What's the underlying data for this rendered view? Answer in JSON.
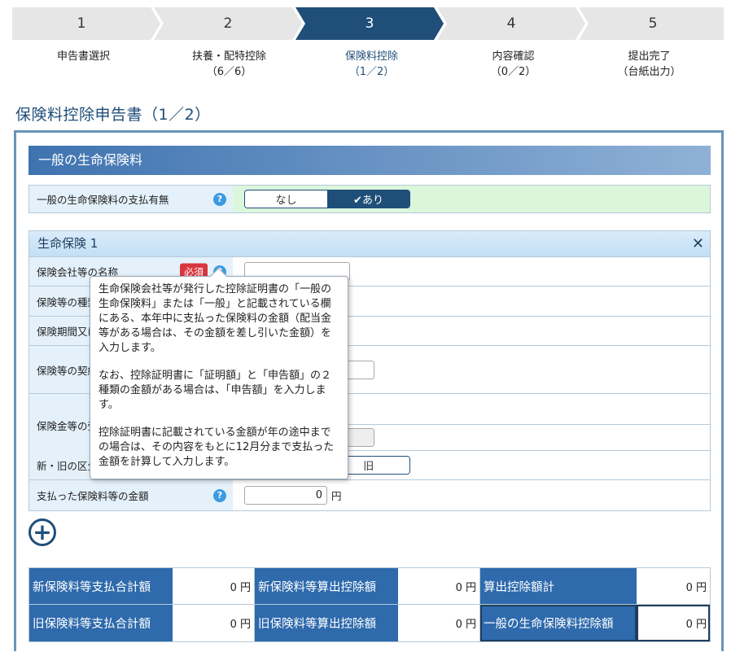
{
  "colors": {
    "primary": "#1f4e79",
    "active_step": "#1f4e79",
    "inactive_step": "#e6e6e6",
    "label_bg": "#e4f1fb",
    "toggle_area_bg": "#dcf6dc",
    "required": "#d9363e",
    "summary_label": "#2e6aac"
  },
  "steps": [
    {
      "number": "1",
      "label": "申告書選択",
      "sub": ""
    },
    {
      "number": "2",
      "label": "扶養・配特控除",
      "sub": "（6／6）"
    },
    {
      "number": "3",
      "label": "保険料控除",
      "sub": "（1／2）",
      "active": true
    },
    {
      "number": "4",
      "label": "内容確認",
      "sub": "（0／2）"
    },
    {
      "number": "5",
      "label": "提出完了",
      "sub": "（台紙出力）"
    }
  ],
  "page_title": "保険料控除申告書（1／2）",
  "section": {
    "title": "一般の生命保険料",
    "payment_row": {
      "label": "一般の生命保険料の支払有無",
      "help_icon": "question-circle-icon",
      "option_no": "なし",
      "option_yes": "✔あり"
    }
  },
  "insurance": {
    "title": "生命保険 1",
    "close_icon": "close-icon",
    "rows": {
      "company": {
        "label": "保険会社等の名称",
        "required": "必須"
      },
      "type": {
        "label": "保険等の種類"
      },
      "period": {
        "label": "保険期間又は年金支払期間"
      },
      "contractor": {
        "label": "保険等の契約者の氏名"
      },
      "recipient": {
        "label": "保険金等の受取人"
      },
      "new_old": {
        "label": "新・旧の区分",
        "old_option": "旧"
      },
      "amount": {
        "label": "支払った保険料等の金額",
        "value": "0",
        "unit": "円"
      }
    }
  },
  "tooltip": {
    "para1": "生命保険会社等が発行した控除証明書の「一般の生命保険料」または「一般」と記載されている欄にある、本年中に支払った保険料の金額（配当金等がある場合は、その金額を差し引いた金額）を入力します。",
    "para2": "なお、控除証明書に「証明額」と「申告額」の２種類の金額がある場合は、「申告額」を入力します。",
    "para3": "控除証明書に記載されている金額が年の途中までの場合は、その内容をもとに12月分まで支払った金額を計算して入力します。"
  },
  "add_icon": "plus-circle-icon",
  "summary": {
    "row1": [
      {
        "label": "新保険料等支払合計額",
        "value": "0 円"
      },
      {
        "label": "新保険料等算出控除額",
        "value": "0 円"
      },
      {
        "label": "算出控除額計",
        "value": "0 円"
      }
    ],
    "row2": [
      {
        "label": "旧保険料等支払合計額",
        "value": "0 円"
      },
      {
        "label": "旧保険料等算出控除額",
        "value": "0 円"
      },
      {
        "label": "一般の生命保険料控除額",
        "value": "0 円"
      }
    ]
  }
}
